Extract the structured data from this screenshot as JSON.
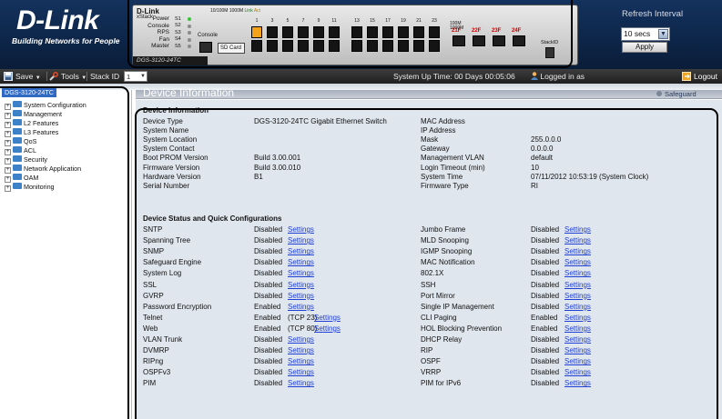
{
  "brand": {
    "logo": "D-Link",
    "tagline": "Building Networks for People"
  },
  "device_panel": {
    "brand": "D-Link",
    "xstack": "xStack",
    "led_labels": [
      "Power",
      "Console",
      "RPS",
      "Fan",
      "Master"
    ],
    "led_codes": [
      "S1",
      "S2",
      "S3",
      "S4",
      "S5"
    ],
    "console_label": "Console",
    "sd_card_label": "SD Card",
    "model": "DGS-3120-24TC",
    "legend_speed": "10/100M 1000M",
    "legend_link": "Link",
    "legend_act": "Act",
    "port_numbers_top": [
      "1",
      "3",
      "5",
      "7",
      "9",
      "11",
      "13",
      "15",
      "17",
      "19",
      "21",
      "23"
    ],
    "combo_labels": [
      "21F",
      "22F",
      "23F",
      "24F"
    ],
    "stack_id_label": "StackID",
    "speed_100m": "100M",
    "speed_1000m": "1000M"
  },
  "refresh": {
    "label": "Refresh Interval",
    "value": "10 secs",
    "apply": "Apply"
  },
  "toolbar": {
    "save": "Save",
    "tools": "Tools",
    "stack_id_label": "Stack ID",
    "stack_id_value": "1",
    "uptime": "System Up Time: 00 Days 00:05:06",
    "logged_in": "Logged in as",
    "logout": "Logout"
  },
  "sidebar": {
    "root": "DGS-3120-24TC",
    "items": [
      "System Configuration",
      "Management",
      "L2 Features",
      "L3 Features",
      "QoS",
      "ACL",
      "Security",
      "Network Application",
      "OAM",
      "Monitoring"
    ]
  },
  "page": {
    "title": "Device Information",
    "safeguard": "Safeguard",
    "info_section": "Device Information",
    "status_section": "Device Status and Quick Configurations",
    "settings_link": "Settings"
  },
  "device_info_left": [
    {
      "label": "Device Type",
      "value": "DGS-3120-24TC Gigabit Ethernet Switch"
    },
    {
      "label": "System Name",
      "value": ""
    },
    {
      "label": "System Location",
      "value": ""
    },
    {
      "label": "System Contact",
      "value": ""
    },
    {
      "label": "Boot PROM Version",
      "value": "Build 3.00.001"
    },
    {
      "label": "Firmware Version",
      "value": "Build 3.00.010"
    },
    {
      "label": "Hardware Version",
      "value": "B1"
    },
    {
      "label": "Serial Number",
      "value": ""
    }
  ],
  "device_info_right": [
    {
      "label": "MAC Address",
      "value": ""
    },
    {
      "label": "IP Address",
      "value": ""
    },
    {
      "label": "Mask",
      "value": "255.0.0.0"
    },
    {
      "label": "Gateway",
      "value": "0.0.0.0"
    },
    {
      "label": "Management VLAN",
      "value": "default"
    },
    {
      "label": "Login Timeout (min)",
      "value": "10"
    },
    {
      "label": "System Time",
      "value": "07/11/2012 10:53:19 (System Clock)"
    },
    {
      "label": "Firmware Type",
      "value": "RI"
    }
  ],
  "status_left": [
    {
      "feature": "SNTP",
      "state": "Disabled",
      "note": ""
    },
    {
      "feature": "Spanning Tree",
      "state": "Disabled",
      "note": ""
    },
    {
      "feature": "SNMP",
      "state": "Disabled",
      "note": ""
    },
    {
      "feature": "Safeguard Engine",
      "state": "Disabled",
      "note": ""
    },
    {
      "feature": "System Log",
      "state": "Disabled",
      "note": ""
    },
    {
      "feature": "SSL",
      "state": "Disabled",
      "note": ""
    },
    {
      "feature": "GVRP",
      "state": "Disabled",
      "note": ""
    },
    {
      "feature": "Password Encryption",
      "state": "Enabled",
      "note": ""
    },
    {
      "feature": "Telnet",
      "state": "Enabled",
      "note": "(TCP 23)"
    },
    {
      "feature": "Web",
      "state": "Enabled",
      "note": "(TCP 80)"
    },
    {
      "feature": "VLAN Trunk",
      "state": "Disabled",
      "note": ""
    },
    {
      "feature": "DVMRP",
      "state": "Disabled",
      "note": ""
    },
    {
      "feature": "RIPng",
      "state": "Disabled",
      "note": ""
    },
    {
      "feature": "OSPFv3",
      "state": "Disabled",
      "note": ""
    },
    {
      "feature": "PIM",
      "state": "Disabled",
      "note": ""
    }
  ],
  "status_right": [
    {
      "feature": "Jumbo Frame",
      "state": "Disabled"
    },
    {
      "feature": "MLD Snooping",
      "state": "Disabled"
    },
    {
      "feature": "IGMP Snooping",
      "state": "Disabled"
    },
    {
      "feature": "MAC Notification",
      "state": "Disabled"
    },
    {
      "feature": "802.1X",
      "state": "Disabled"
    },
    {
      "feature": "SSH",
      "state": "Disabled"
    },
    {
      "feature": "Port Mirror",
      "state": "Disabled"
    },
    {
      "feature": "Single IP Management",
      "state": "Disabled"
    },
    {
      "feature": "CLI Paging",
      "state": "Enabled"
    },
    {
      "feature": "HOL Blocking Prevention",
      "state": "Enabled"
    },
    {
      "feature": "DHCP Relay",
      "state": "Disabled"
    },
    {
      "feature": "RIP",
      "state": "Disabled"
    },
    {
      "feature": "OSPF",
      "state": "Disabled"
    },
    {
      "feature": "VRRP",
      "state": "Disabled"
    },
    {
      "feature": "PIM for IPv6",
      "state": "Disabled"
    }
  ],
  "colors": {
    "header_bg": "#14325e",
    "toolbar_bg": "#2e2e2e",
    "panel_bg": "#dfe6ed",
    "link": "#1f3ed6",
    "tree_selected": "#316ac5",
    "port_link": "#f3a21a"
  }
}
